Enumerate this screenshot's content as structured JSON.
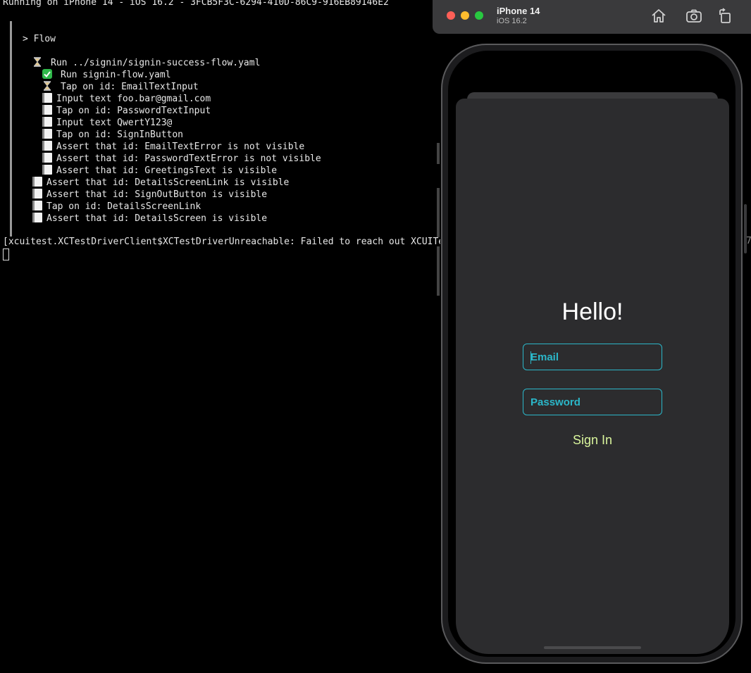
{
  "terminal": {
    "header": "Running on iPhone 14 - iOS 16.2 - 3FCB5F3C-6294-410D-86C9-916EB89146E2",
    "flow_label": "> Flow",
    "steps": [
      {
        "status": "running",
        "text": "Run ../signin/signin-success-flow.yaml"
      },
      {
        "status": "done",
        "text": "Run signin-flow.yaml"
      },
      {
        "status": "running",
        "text": "Tap on id: EmailTextInput"
      },
      {
        "status": "pending",
        "text": "Input text foo.bar@gmail.com"
      },
      {
        "status": "pending",
        "text": "Tap on id: PasswordTextInput"
      },
      {
        "status": "pending",
        "text": "Input text QwertY123@"
      },
      {
        "status": "pending",
        "text": "Tap on id: SignInButton"
      },
      {
        "status": "pending",
        "text": "Assert that id: EmailTextError is not visible"
      },
      {
        "status": "pending",
        "text": "Assert that id: PasswordTextError is not visible"
      },
      {
        "status": "pending",
        "text": "Assert that id: GreetingsText is visible"
      },
      {
        "status": "pending",
        "text": "Assert that id: DetailsScreenLink is visible"
      },
      {
        "status": "pending",
        "text": "Assert that id: SignOutButton is visible"
      },
      {
        "status": "pending",
        "text": "Tap on id: DetailsScreenLink"
      },
      {
        "status": "pending",
        "text": "Assert that id: DetailsScreen is visible"
      }
    ],
    "error": "[xcuitest.XCTestDriverClient$XCTestDriverUnreachable: Failed to reach out XCUITest Server",
    "error_tail": "7"
  },
  "simulator": {
    "device_name": "iPhone 14",
    "os_version": "iOS 16.2",
    "toolbar": {
      "home_icon": "home-icon",
      "screenshot_icon": "camera-icon",
      "rotate_icon": "rotate-icon"
    },
    "app": {
      "greeting": "Hello!",
      "email_placeholder": "Email",
      "password_placeholder": "Password",
      "sign_in_label": "Sign In"
    },
    "colors": {
      "accent": "#2bb7c9",
      "sign_in": "#d9f59c",
      "sheet_bg": "#2c2c2e"
    }
  }
}
